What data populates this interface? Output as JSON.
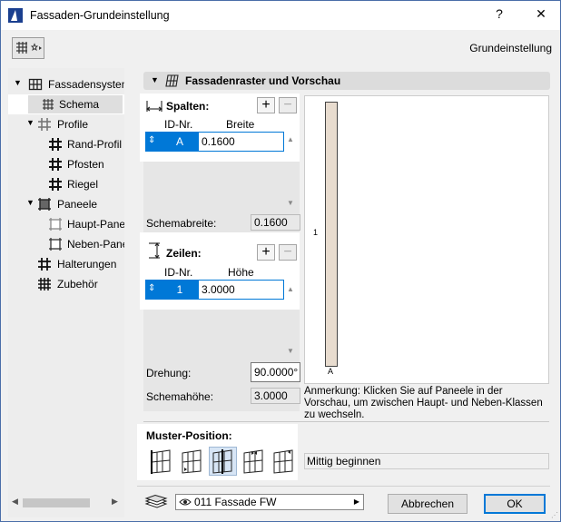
{
  "window": {
    "title": "Fassaden-Grundeinstellung",
    "help_label": "?",
    "close_label": "✕",
    "subtitle": "Grundeinstellung"
  },
  "tree": {
    "items": [
      {
        "label": "Fassadensystem",
        "expanded": true
      },
      {
        "label": "Schema",
        "selected": true
      },
      {
        "label": "Profile",
        "expanded": true
      },
      {
        "label": "Rand-Profil"
      },
      {
        "label": "Pfosten"
      },
      {
        "label": "Riegel"
      },
      {
        "label": "Paneele",
        "expanded": true
      },
      {
        "label": "Haupt-Paneel"
      },
      {
        "label": "Neben-Paneel"
      },
      {
        "label": "Halterungen"
      },
      {
        "label": "Zubehör"
      }
    ]
  },
  "section": {
    "title": "Fassadenraster und Vorschau"
  },
  "spalten": {
    "header": "Spalten:",
    "col_id": "ID-Nr.",
    "col_value": "Breite",
    "rows": [
      {
        "id": "A",
        "value": "0.1600"
      }
    ],
    "total_label": "Schemabreite:",
    "total_value": "0.1600"
  },
  "zeilen": {
    "header": "Zeilen:",
    "col_id": "ID-Nr.",
    "col_value": "Höhe",
    "rows": [
      {
        "id": "1",
        "value": "3.0000"
      }
    ]
  },
  "fields": {
    "drehung_label": "Drehung:",
    "drehung_value": "90.0000°",
    "schemahoehe_label": "Schemahöhe:",
    "schemahoehe_value": "3.0000"
  },
  "preview": {
    "row_label": "1",
    "col_label": "A",
    "note": "Anmerkung: Klicken Sie auf Paneele in der Vorschau, um zwischen Haupt- und Neben-Klassen zu wechseln."
  },
  "pattern": {
    "header": "Muster-Position:",
    "selected_index": 2,
    "mode_value": "Mittig beginnen"
  },
  "footer": {
    "layer_value": "011 Fassade FW",
    "cancel_label": "Abbrechen",
    "ok_label": "OK"
  },
  "colors": {
    "accent": "#0078d7",
    "panel_fill": "#e8dccf"
  }
}
